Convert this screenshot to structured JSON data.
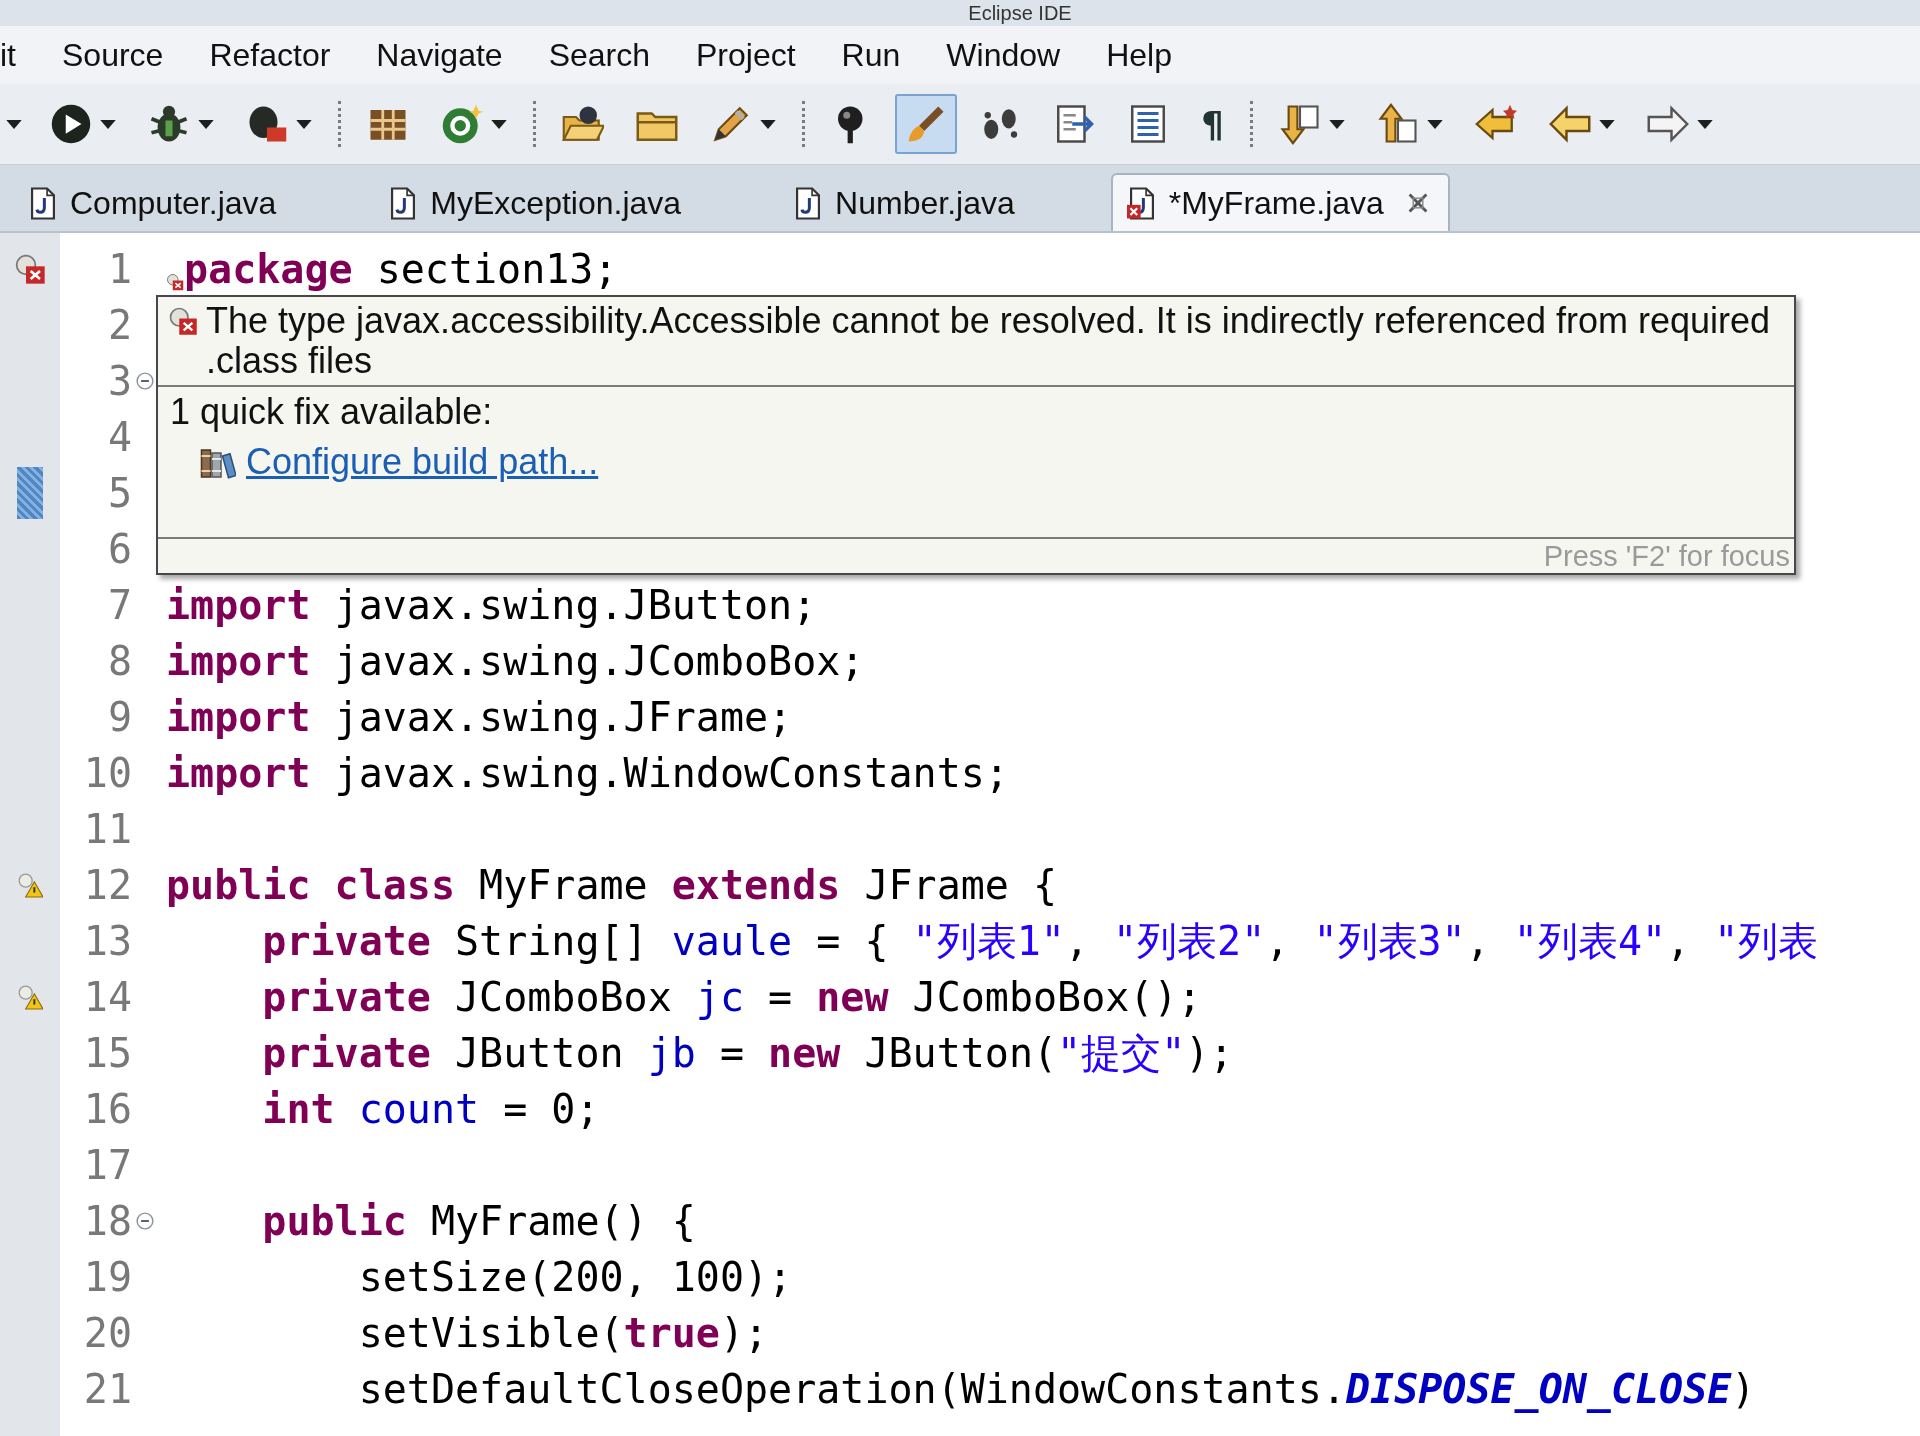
{
  "window": {
    "title": "Eclipse IDE"
  },
  "menu": [
    "it",
    "Source",
    "Refactor",
    "Navigate",
    "Search",
    "Project",
    "Run",
    "Window",
    "Help"
  ],
  "toolbar": [
    {
      "kind": "caret"
    },
    {
      "kind": "run",
      "dropdown": true,
      "pressed": false
    },
    {
      "kind": "debug",
      "dropdown": true,
      "pressed": false
    },
    {
      "kind": "coverage",
      "dropdown": true,
      "pressed": false
    },
    {
      "kind": "separator"
    },
    {
      "kind": "package",
      "dropdown": false,
      "pressed": false
    },
    {
      "kind": "class",
      "dropdown": true,
      "pressed": false
    },
    {
      "kind": "separator"
    },
    {
      "kind": "open-type",
      "dropdown": false,
      "pressed": false
    },
    {
      "kind": "folder",
      "dropdown": false,
      "pressed": false
    },
    {
      "kind": "pencil",
      "dropdown": true,
      "pressed": false
    },
    {
      "kind": "separator"
    },
    {
      "kind": "pin",
      "dropdown": false,
      "pressed": false
    },
    {
      "kind": "brush",
      "dropdown": false,
      "pressed": true
    },
    {
      "kind": "footprints",
      "dropdown": false,
      "pressed": false
    },
    {
      "kind": "doc-arrows",
      "dropdown": false,
      "pressed": false
    },
    {
      "kind": "doc-lines",
      "dropdown": false,
      "pressed": false
    },
    {
      "kind": "glyph",
      "text": "¶",
      "dropdown": false,
      "pressed": false
    },
    {
      "kind": "separator"
    },
    {
      "kind": "arrow-down",
      "dropdown": true,
      "pressed": false
    },
    {
      "kind": "arrow-up",
      "dropdown": true,
      "pressed": false
    },
    {
      "kind": "last-edit",
      "dropdown": false,
      "pressed": false
    },
    {
      "kind": "back",
      "dropdown": true,
      "pressed": false
    },
    {
      "kind": "forward",
      "dropdown": true,
      "pressed": false
    }
  ],
  "tabs": [
    {
      "label": "Computer.java",
      "selected": false,
      "error": false
    },
    {
      "label": "MyException.java",
      "selected": false,
      "error": false
    },
    {
      "label": "Number.java",
      "selected": false,
      "error": false
    },
    {
      "label": "*MyFrame.java",
      "selected": true,
      "error": true
    }
  ],
  "editor": {
    "lines": [
      {
        "number": "1",
        "marker": {
          "kind": "error"
        },
        "problem": true,
        "code": [
          {
            "text": "package",
            "kind": "keyword"
          },
          {
            "text": " section13;",
            "kind": "plain"
          }
        ]
      },
      {
        "number": "2",
        "problem": false
      },
      {
        "number": "3",
        "fold": {
          "collapsed": false
        },
        "problem": false
      },
      {
        "number": "4",
        "problem": false
      },
      {
        "number": "5",
        "marker": {
          "kind": "change"
        },
        "problem": false
      },
      {
        "number": "6",
        "problem": false
      },
      {
        "number": "7",
        "problem": false,
        "code": [
          {
            "text": "import",
            "kind": "keyword"
          },
          {
            "text": " javax.swing.JButton;",
            "kind": "plain"
          }
        ]
      },
      {
        "number": "8",
        "problem": false,
        "code": [
          {
            "text": "import",
            "kind": "keyword"
          },
          {
            "text": " javax.swing.JComboBox;",
            "kind": "plain"
          }
        ]
      },
      {
        "number": "9",
        "problem": false,
        "code": [
          {
            "text": "import",
            "kind": "keyword"
          },
          {
            "text": " javax.swing.JFrame;",
            "kind": "plain"
          }
        ]
      },
      {
        "number": "10",
        "problem": false,
        "code": [
          {
            "text": "import",
            "kind": "keyword"
          },
          {
            "text": " javax.swing.WindowConstants;",
            "kind": "plain"
          }
        ]
      },
      {
        "number": "11",
        "problem": false
      },
      {
        "number": "12",
        "marker": {
          "kind": "warning"
        },
        "problem": false,
        "code": [
          {
            "text": "public class",
            "kind": "keyword"
          },
          {
            "text": " MyFrame ",
            "kind": "plain"
          },
          {
            "text": "extends",
            "kind": "keyword"
          },
          {
            "text": " JFrame {",
            "kind": "plain"
          }
        ]
      },
      {
        "number": "13",
        "problem": false,
        "code": [
          {
            "text": "    private",
            "kind": "keyword"
          },
          {
            "text": " String[] ",
            "kind": "plain"
          },
          {
            "text": "vaule",
            "kind": "field"
          },
          {
            "text": " = { ",
            "kind": "plain"
          },
          {
            "text": "\"列表1\"",
            "kind": "string"
          },
          {
            "text": ", ",
            "kind": "plain"
          },
          {
            "text": "\"列表2\"",
            "kind": "string"
          },
          {
            "text": ", ",
            "kind": "plain"
          },
          {
            "text": "\"列表3\"",
            "kind": "string"
          },
          {
            "text": ", ",
            "kind": "plain"
          },
          {
            "text": "\"列表4\"",
            "kind": "string"
          },
          {
            "text": ", ",
            "kind": "plain"
          },
          {
            "text": "\"列表",
            "kind": "string"
          }
        ]
      },
      {
        "number": "14",
        "marker": {
          "kind": "warning"
        },
        "problem": false,
        "code": [
          {
            "text": "    private",
            "kind": "keyword"
          },
          {
            "text": " JComboBox ",
            "kind": "plain"
          },
          {
            "text": "jc",
            "kind": "field"
          },
          {
            "text": " = ",
            "kind": "plain"
          },
          {
            "text": "new",
            "kind": "keyword"
          },
          {
            "text": " JComboBox();",
            "kind": "plain"
          }
        ]
      },
      {
        "number": "15",
        "problem": false,
        "code": [
          {
            "text": "    private",
            "kind": "keyword"
          },
          {
            "text": " JButton ",
            "kind": "plain"
          },
          {
            "text": "jb",
            "kind": "field"
          },
          {
            "text": " = ",
            "kind": "plain"
          },
          {
            "text": "new",
            "kind": "keyword"
          },
          {
            "text": " JButton(",
            "kind": "plain"
          },
          {
            "text": "\"提交\"",
            "kind": "string"
          },
          {
            "text": ");",
            "kind": "plain"
          }
        ]
      },
      {
        "number": "16",
        "problem": false,
        "code": [
          {
            "text": "    int ",
            "kind": "keyword"
          },
          {
            "text": "count",
            "kind": "field"
          },
          {
            "text": " = 0;",
            "kind": "plain"
          }
        ]
      },
      {
        "number": "17",
        "problem": false
      },
      {
        "number": "18",
        "fold": {
          "collapsed": false
        },
        "problem": false,
        "code": [
          {
            "text": "    public",
            "kind": "keyword"
          },
          {
            "text": " MyFrame() {",
            "kind": "plain"
          }
        ]
      },
      {
        "number": "19",
        "problem": false,
        "code": [
          {
            "text": "        setSize(200, 100);",
            "kind": "plain"
          }
        ]
      },
      {
        "number": "20",
        "problem": false,
        "code": [
          {
            "text": "        setVisible(",
            "kind": "plain"
          },
          {
            "text": "true",
            "kind": "keyword"
          },
          {
            "text": ");",
            "kind": "plain"
          }
        ]
      },
      {
        "number": "21",
        "problem": false,
        "code": [
          {
            "text": "        setDefaultCloseOperation(WindowConstants.",
            "kind": "plain"
          },
          {
            "text": "DISPOSE_ON_CLOSE",
            "kind": "constant"
          },
          {
            "text": ")",
            "kind": "plain"
          }
        ]
      }
    ]
  },
  "hover": {
    "message": "The type javax.accessibility.Accessible cannot be resolved. It is indirectly referenced from required .class files",
    "quick_fix_heading": "1 quick fix available:",
    "fixes": [
      {
        "label": "Configure build path..."
      }
    ],
    "footer": "Press 'F2' for focus"
  }
}
